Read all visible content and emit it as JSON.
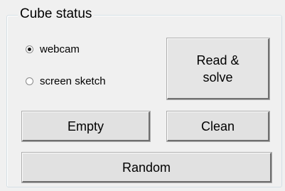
{
  "group": {
    "title": "Cube status"
  },
  "source_options": [
    {
      "label": "webcam",
      "selected": true
    },
    {
      "label": "screen sketch",
      "selected": false
    }
  ],
  "buttons": {
    "read_solve": "Read &\nsolve",
    "empty": "Empty",
    "clean": "Clean",
    "random": "Random"
  }
}
